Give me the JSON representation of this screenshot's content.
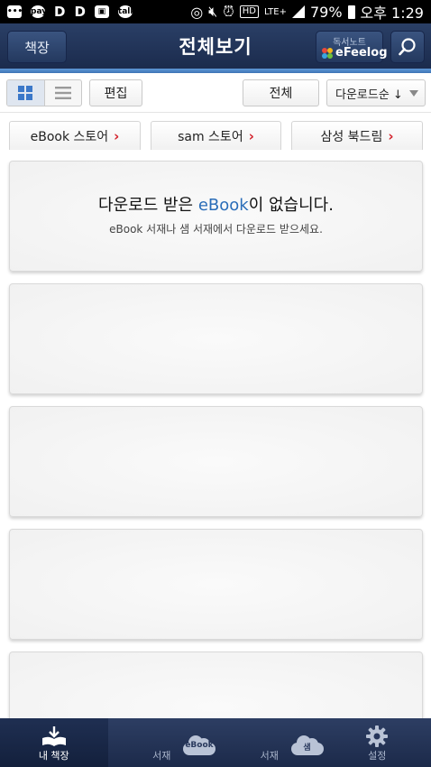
{
  "status_bar": {
    "lte": "LTE+",
    "battery": "79%",
    "time": "오후 1:29"
  },
  "header": {
    "bookshelf_label": "책장",
    "title": "전체보기",
    "efeelog_top": "독서노트",
    "efeelog_label": "eFeelog"
  },
  "toolbar": {
    "edit_label": "편집",
    "filter_label": "전체",
    "sort_label": "다운로드순 ↓"
  },
  "stores": [
    {
      "label": "eBook 스토어"
    },
    {
      "label": "sam 스토어"
    },
    {
      "label": "삼성 북드림"
    }
  ],
  "empty_state": {
    "title_before": "다운로드 받은 ",
    "title_highlight": "eBook",
    "title_after": "이 없습니다.",
    "subtitle": "eBook 서재나 샘 서재에서 다운로드 받으세요."
  },
  "bottom_nav": {
    "my_shelf": "내 책장",
    "ebook_badge": "eBook",
    "ebook_label": "서재",
    "sam_badge": "샘",
    "sam_label": "서재",
    "settings_label": "설정"
  },
  "colors": {
    "header": "#1b2b4d",
    "accent": "#3e74b5",
    "chevron": "#d3202a",
    "highlight": "#2a6db8"
  }
}
